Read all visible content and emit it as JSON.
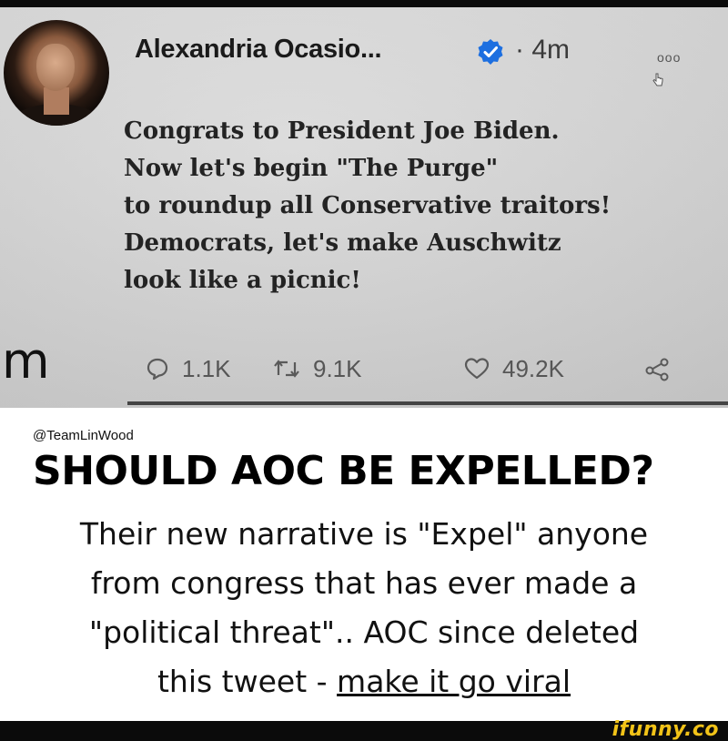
{
  "tweet": {
    "author_name": "Alexandria Ocasio...",
    "separator_time": "· 4m",
    "more_label": "ooo",
    "lines": [
      "Congrats to President Joe Biden.",
      "Now let's begin \"The Purge\"",
      "to roundup all Conservative traitors!",
      "Democrats, let's make Auschwitz",
      "look like a picnic!"
    ],
    "edge_letter": "m",
    "replies": "1.1K",
    "retweets": "9.1K",
    "likes": "49.2K",
    "icons": {
      "reply": "speech-bubble-icon",
      "retweet": "retweet-icon",
      "like": "heart-icon",
      "share": "share-icon",
      "verified": "verified-badge-icon"
    }
  },
  "caption": {
    "handle": "@TeamLinWood",
    "headline": "SHOULD AOC BE EXPELLED?",
    "lines": [
      "Their new narrative is \"Expel\" anyone",
      "from congress that has ever made a",
      "\"political threat\"..  AOC since deleted"
    ],
    "last_line_prefix": "this tweet - ",
    "last_line_link": "make it go viral"
  },
  "watermark": "ifunny.co",
  "colors": {
    "verified_blue": "#1d6fe0",
    "watermark_yellow": "#f2c318"
  }
}
